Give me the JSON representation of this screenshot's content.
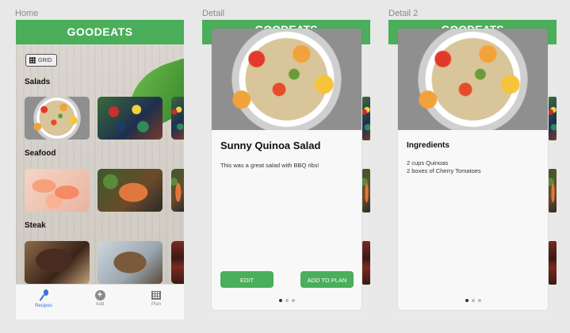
{
  "artboards": {
    "home_label": "Home",
    "detail_label": "Detail",
    "detail2_label": "Detail 2"
  },
  "home": {
    "header_title": "GOODEATS",
    "grid_button_label": "GRID",
    "sections": [
      {
        "label": "Salads"
      },
      {
        "label": "Seafood"
      },
      {
        "label": "Steak"
      }
    ],
    "tabs": [
      {
        "label": "Recipes",
        "icon": "spoon-icon",
        "active": true
      },
      {
        "label": "Add",
        "icon": "add-icon",
        "active": false
      },
      {
        "label": "Plan",
        "icon": "calendar-icon",
        "active": false
      }
    ],
    "add_glyph": "+"
  },
  "detail": {
    "header_title": "GOODEATS",
    "recipe_title": "Sunny Quinoa Salad",
    "notes": "This was a great salad with BBQ ribs!",
    "edit_label": "EDIT",
    "add_to_plan_label": "ADD TO PLAN",
    "page_count": 3,
    "active_page": 1
  },
  "detail2": {
    "header_title": "GOODEATS",
    "ingredients_heading": "Ingredients",
    "ingredients": [
      "2 cups Quinoas",
      "2 boxes of Cherry Tomatoes"
    ],
    "page_count": 3,
    "active_page": 1
  },
  "colors": {
    "brand_green": "#4aae5a",
    "active_tab_blue": "#3b73d9"
  }
}
